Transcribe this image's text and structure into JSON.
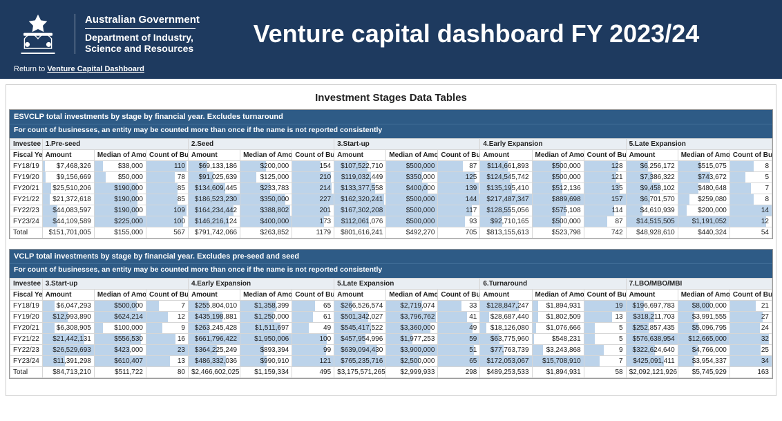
{
  "header": {
    "gov": "Australian Government",
    "dept1": "Department of Industry,",
    "dept2": "Science and Resources",
    "title": "Venture capital dashboard FY 2023/24",
    "return_prefix": "Return to ",
    "return_link": "Venture Capital Dashboard"
  },
  "section_title": "Investment Stages Data Tables",
  "table1": {
    "caption1": "ESVCLP total investments by stage by financial year. Excludes turnaround",
    "caption2": "For count of businesses, an entity may be counted more than once if the name is not reported consistently",
    "stage_label": "Investee Stage",
    "fy_label": "Fiscal Year",
    "col_amount": "Amount",
    "col_median": "Median of Amount",
    "col_count": "Count of Businesses",
    "stages": [
      "1.Pre-seed",
      "2.Seed",
      "3.Start-up",
      "4.Early Expansion",
      "5.Late Expansion"
    ],
    "rows": [
      {
        "fy": "FY18/19",
        "cells": [
          {
            "a": "$7,468,326",
            "aw": 5,
            "m": "$38,000",
            "mw": 17,
            "c": "110",
            "cw": 97
          },
          {
            "a": "$69,133,186",
            "aw": 37,
            "m": "$200,000",
            "mw": 50,
            "c": "154",
            "cw": 68
          },
          {
            "a": "$107,522,710",
            "aw": 64,
            "m": "$500,000",
            "mw": 100,
            "c": "87",
            "cw": 60
          },
          {
            "a": "$114,661,893",
            "aw": 53,
            "m": "$500,000",
            "mw": 56,
            "c": "128",
            "cw": 82
          },
          {
            "a": "$6,256,172",
            "aw": 43,
            "m": "$515,075",
            "mw": 43,
            "c": "8",
            "cw": 57
          }
        ]
      },
      {
        "fy": "FY19/20",
        "cells": [
          {
            "a": "$9,156,669",
            "aw": 6,
            "m": "$50,000",
            "mw": 22,
            "c": "78",
            "cw": 69
          },
          {
            "a": "$91,025,639",
            "aw": 49,
            "m": "$125,000",
            "mw": 31,
            "c": "210",
            "cw": 93
          },
          {
            "a": "$119,032,449",
            "aw": 71,
            "m": "$350,000",
            "mw": 70,
            "c": "125",
            "cw": 87
          },
          {
            "a": "$124,545,742",
            "aw": 57,
            "m": "$500,000",
            "mw": 56,
            "c": "121",
            "cw": 77
          },
          {
            "a": "$7,386,322",
            "aw": 51,
            "m": "$743,672",
            "mw": 62,
            "c": "5",
            "cw": 36
          }
        ]
      },
      {
        "fy": "FY20/21",
        "cells": [
          {
            "a": "$25,510,206",
            "aw": 17,
            "m": "$190,000",
            "mw": 84,
            "c": "85",
            "cw": 75
          },
          {
            "a": "$134,609,445",
            "aw": 72,
            "m": "$233,783",
            "mw": 58,
            "c": "214",
            "cw": 94
          },
          {
            "a": "$133,377,558",
            "aw": 80,
            "m": "$400,000",
            "mw": 80,
            "c": "139",
            "cw": 97
          },
          {
            "a": "$135,195,410",
            "aw": 62,
            "m": "$512,136",
            "mw": 58,
            "c": "135",
            "cw": 86
          },
          {
            "a": "$9,458,102",
            "aw": 65,
            "m": "$480,648",
            "mw": 40,
            "c": "7",
            "cw": 50
          }
        ]
      },
      {
        "fy": "FY21/22",
        "cells": [
          {
            "a": "$21,372,618",
            "aw": 14,
            "m": "$190,000",
            "mw": 84,
            "c": "85",
            "cw": 75
          },
          {
            "a": "$186,523,230",
            "aw": 100,
            "m": "$350,000",
            "mw": 88,
            "c": "227",
            "cw": 100
          },
          {
            "a": "$162,320,241",
            "aw": 97,
            "m": "$500,000",
            "mw": 100,
            "c": "144",
            "cw": 100
          },
          {
            "a": "$217,487,347",
            "aw": 100,
            "m": "$889,698",
            "mw": 100,
            "c": "157",
            "cw": 100
          },
          {
            "a": "$6,701,570",
            "aw": 46,
            "m": "$259,080",
            "mw": 22,
            "c": "8",
            "cw": 57
          }
        ]
      },
      {
        "fy": "FY22/23",
        "cells": [
          {
            "a": "$44,083,597",
            "aw": 29,
            "m": "$190,000",
            "mw": 84,
            "c": "109",
            "cw": 96
          },
          {
            "a": "$164,234,442",
            "aw": 88,
            "m": "$388,802",
            "mw": 97,
            "c": "201",
            "cw": 89
          },
          {
            "a": "$167,302,208",
            "aw": 100,
            "m": "$500,000",
            "mw": 100,
            "c": "117",
            "cw": 81
          },
          {
            "a": "$128,555,056",
            "aw": 59,
            "m": "$575,108",
            "mw": 65,
            "c": "114",
            "cw": 73
          },
          {
            "a": "$4,610,939",
            "aw": 32,
            "m": "$200,000",
            "mw": 17,
            "c": "14",
            "cw": 100
          }
        ]
      },
      {
        "fy": "FY23/24",
        "cells": [
          {
            "a": "$44,109,589",
            "aw": 29,
            "m": "$225,000",
            "mw": 100,
            "c": "100",
            "cw": 88
          },
          {
            "a": "$146,216,124",
            "aw": 78,
            "m": "$400,000",
            "mw": 100,
            "c": "173",
            "cw": 76
          },
          {
            "a": "$112,061,076",
            "aw": 67,
            "m": "$500,000",
            "mw": 100,
            "c": "93",
            "cw": 65
          },
          {
            "a": "$92,710,165",
            "aw": 43,
            "m": "$500,000",
            "mw": 56,
            "c": "87",
            "cw": 55
          },
          {
            "a": "$14,515,505",
            "aw": 100,
            "m": "$1,191,052",
            "mw": 100,
            "c": "12",
            "cw": 86
          }
        ]
      }
    ],
    "total": {
      "fy": "Total",
      "cells": [
        {
          "a": "$151,701,005",
          "m": "$155,000",
          "c": "567"
        },
        {
          "a": "$791,742,066",
          "m": "$263,852",
          "c": "1179"
        },
        {
          "a": "$801,616,241",
          "m": "$492,270",
          "c": "705"
        },
        {
          "a": "$813,155,613",
          "m": "$523,798",
          "c": "742"
        },
        {
          "a": "$48,928,610",
          "m": "$440,324",
          "c": "54"
        }
      ]
    }
  },
  "table2": {
    "caption1": "VCLP total investments by stage by financial year. Excludes pre-seed and seed",
    "caption2": "For count of businesses, an entity may be counted more than once if the name is not reported consistently",
    "stage_label": "Investee Stage",
    "fy_label": "Fiscal Year",
    "col_amount": "Amount",
    "col_median": "Median of Amount",
    "col_count": "Count of Businesses",
    "stages": [
      "3.Start-up",
      "4.Early Expansion",
      "5.Late Expansion",
      "6.Turnaround",
      "7.LBO/MBO/MBI"
    ],
    "rows": [
      {
        "fy": "FY18/19",
        "cells": [
          {
            "a": "$6,047,293",
            "aw": 23,
            "m": "$500,000",
            "mw": 82,
            "c": "7",
            "cw": 30
          },
          {
            "a": "$255,804,010",
            "aw": 39,
            "m": "$1,358,399",
            "mw": 70,
            "c": "65",
            "cw": 54
          },
          {
            "a": "$266,526,574",
            "aw": 35,
            "m": "$2,719,074",
            "mw": 70,
            "c": "33",
            "cw": 56
          },
          {
            "a": "$128,847,247",
            "aw": 75,
            "m": "$1,894,931",
            "mw": 12,
            "c": "19",
            "cw": 100
          },
          {
            "a": "$196,697,783",
            "aw": 34,
            "m": "$8,000,000",
            "mw": 63,
            "c": "21",
            "cw": 62
          }
        ]
      },
      {
        "fy": "FY19/20",
        "cells": [
          {
            "a": "$12,993,890",
            "aw": 49,
            "m": "$624,214",
            "mw": 100,
            "c": "12",
            "cw": 52
          },
          {
            "a": "$435,198,881",
            "aw": 66,
            "m": "$1,250,000",
            "mw": 64,
            "c": "61",
            "cw": 50
          },
          {
            "a": "$501,342,027",
            "aw": 66,
            "m": "$3,796,762",
            "mw": 97,
            "c": "41",
            "cw": 69
          },
          {
            "a": "$28,687,440",
            "aw": 17,
            "m": "$1,802,509",
            "mw": 11,
            "c": "13",
            "cw": 68
          },
          {
            "a": "$318,211,703",
            "aw": 55,
            "m": "$3,991,555",
            "mw": 32,
            "c": "27",
            "cw": 79
          }
        ]
      },
      {
        "fy": "FY20/21",
        "cells": [
          {
            "a": "$6,308,905",
            "aw": 24,
            "m": "$100,000",
            "mw": 16,
            "c": "9",
            "cw": 39
          },
          {
            "a": "$263,245,428",
            "aw": 40,
            "m": "$1,511,697",
            "mw": 78,
            "c": "49",
            "cw": 40
          },
          {
            "a": "$545,417,522",
            "aw": 71,
            "m": "$3,360,000",
            "mw": 86,
            "c": "49",
            "cw": 83
          },
          {
            "a": "$18,126,080",
            "aw": 11,
            "m": "$1,076,666",
            "mw": 7,
            "c": "5",
            "cw": 26
          },
          {
            "a": "$252,857,435",
            "aw": 44,
            "m": "$5,096,795",
            "mw": 40,
            "c": "24",
            "cw": 71
          }
        ]
      },
      {
        "fy": "FY21/22",
        "cells": [
          {
            "a": "$21,442,131",
            "aw": 81,
            "m": "$556,530",
            "mw": 91,
            "c": "16",
            "cw": 70
          },
          {
            "a": "$661,796,422",
            "aw": 100,
            "m": "$1,950,006",
            "mw": 100,
            "c": "100",
            "cw": 83
          },
          {
            "a": "$457,954,996",
            "aw": 60,
            "m": "$1,977,253",
            "mw": 51,
            "c": "59",
            "cw": 100
          },
          {
            "a": "$63,775,960",
            "aw": 37,
            "m": "$548,231",
            "mw": 3,
            "c": "5",
            "cw": 26
          },
          {
            "a": "$576,638,954",
            "aw": 100,
            "m": "$12,665,000",
            "mw": 100,
            "c": "32",
            "cw": 94
          }
        ]
      },
      {
        "fy": "FY22/23",
        "cells": [
          {
            "a": "$26,529,693",
            "aw": 100,
            "m": "$423,000",
            "mw": 69,
            "c": "23",
            "cw": 100
          },
          {
            "a": "$364,225,249",
            "aw": 55,
            "m": "$893,394",
            "mw": 46,
            "c": "99",
            "cw": 82
          },
          {
            "a": "$639,094,430",
            "aw": 84,
            "m": "$3,900,000",
            "mw": 100,
            "c": "51",
            "cw": 86
          },
          {
            "a": "$77,763,739",
            "aw": 45,
            "m": "$3,243,868",
            "mw": 21,
            "c": "9",
            "cw": 47
          },
          {
            "a": "$322,624,640",
            "aw": 56,
            "m": "$4,766,000",
            "mw": 38,
            "c": "25",
            "cw": 74
          }
        ]
      },
      {
        "fy": "FY23/24",
        "cells": [
          {
            "a": "$11,391,298",
            "aw": 43,
            "m": "$610,407",
            "mw": 100,
            "c": "13",
            "cw": 57
          },
          {
            "a": "$486,332,036",
            "aw": 73,
            "m": "$990,910",
            "mw": 51,
            "c": "121",
            "cw": 100
          },
          {
            "a": "$765,235,716",
            "aw": 100,
            "m": "$2,500,000",
            "mw": 64,
            "c": "65",
            "cw": 100
          },
          {
            "a": "$172,053,067",
            "aw": 100,
            "m": "$15,708,910",
            "mw": 100,
            "c": "7",
            "cw": 37
          },
          {
            "a": "$425,091,411",
            "aw": 74,
            "m": "$3,954,337",
            "mw": 31,
            "c": "34",
            "cw": 100
          }
        ]
      }
    ],
    "total": {
      "fy": "Total",
      "cells": [
        {
          "a": "$84,713,210",
          "m": "$511,722",
          "c": "80"
        },
        {
          "a": "$2,466,602,025",
          "m": "$1,159,334",
          "c": "495"
        },
        {
          "a": "$3,175,571,265",
          "m": "$2,999,933",
          "c": "298"
        },
        {
          "a": "$489,253,533",
          "m": "$1,894,931",
          "c": "58"
        },
        {
          "a": "$2,092,121,926",
          "m": "$5,745,929",
          "c": "163"
        }
      ]
    }
  }
}
